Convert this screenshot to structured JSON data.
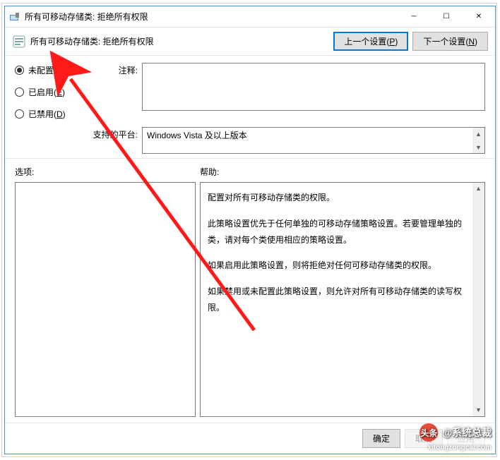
{
  "titlebar": {
    "title": "所有可移动存储类: 拒绝所有权限"
  },
  "toolbar": {
    "title": "所有可移动存储类: 拒绝所有权限",
    "prev": "上一个设置(",
    "prev_key": "P",
    "next": "下一个设置(",
    "next_key": "N",
    "paren_close": ")"
  },
  "radios": {
    "not_configured": "未配置(",
    "not_configured_key": "C",
    "enabled": "已启用(",
    "enabled_key": "E",
    "disabled": "已禁用(",
    "disabled_key": "D",
    "paren_close": ")"
  },
  "labels": {
    "comment": "注释:",
    "platform": "支持的平台:",
    "options": "选项:",
    "help": "帮助:"
  },
  "platform": {
    "text": "Windows Vista 及以上版本"
  },
  "help": {
    "p1": "配置对所有可移动存储类的权限。",
    "p2": "此策略设置优先于任何单独的可移动存储策略设置。若要管理单独的类，请对每个类使用相应的策略设置。",
    "p3": "如果启用此策略设置，则将拒绝对任何可移动存储类的权限。",
    "p4": "如果禁用或未配置此策略设置，则允许对所有可移动存储类的读写权限。"
  },
  "footer": {
    "ok": "确定",
    "cancel": "取消",
    "apply": "应用"
  },
  "watermark": {
    "brand": "@系统总裁",
    "badge": "头条",
    "url": "xitongzongcai.com"
  }
}
